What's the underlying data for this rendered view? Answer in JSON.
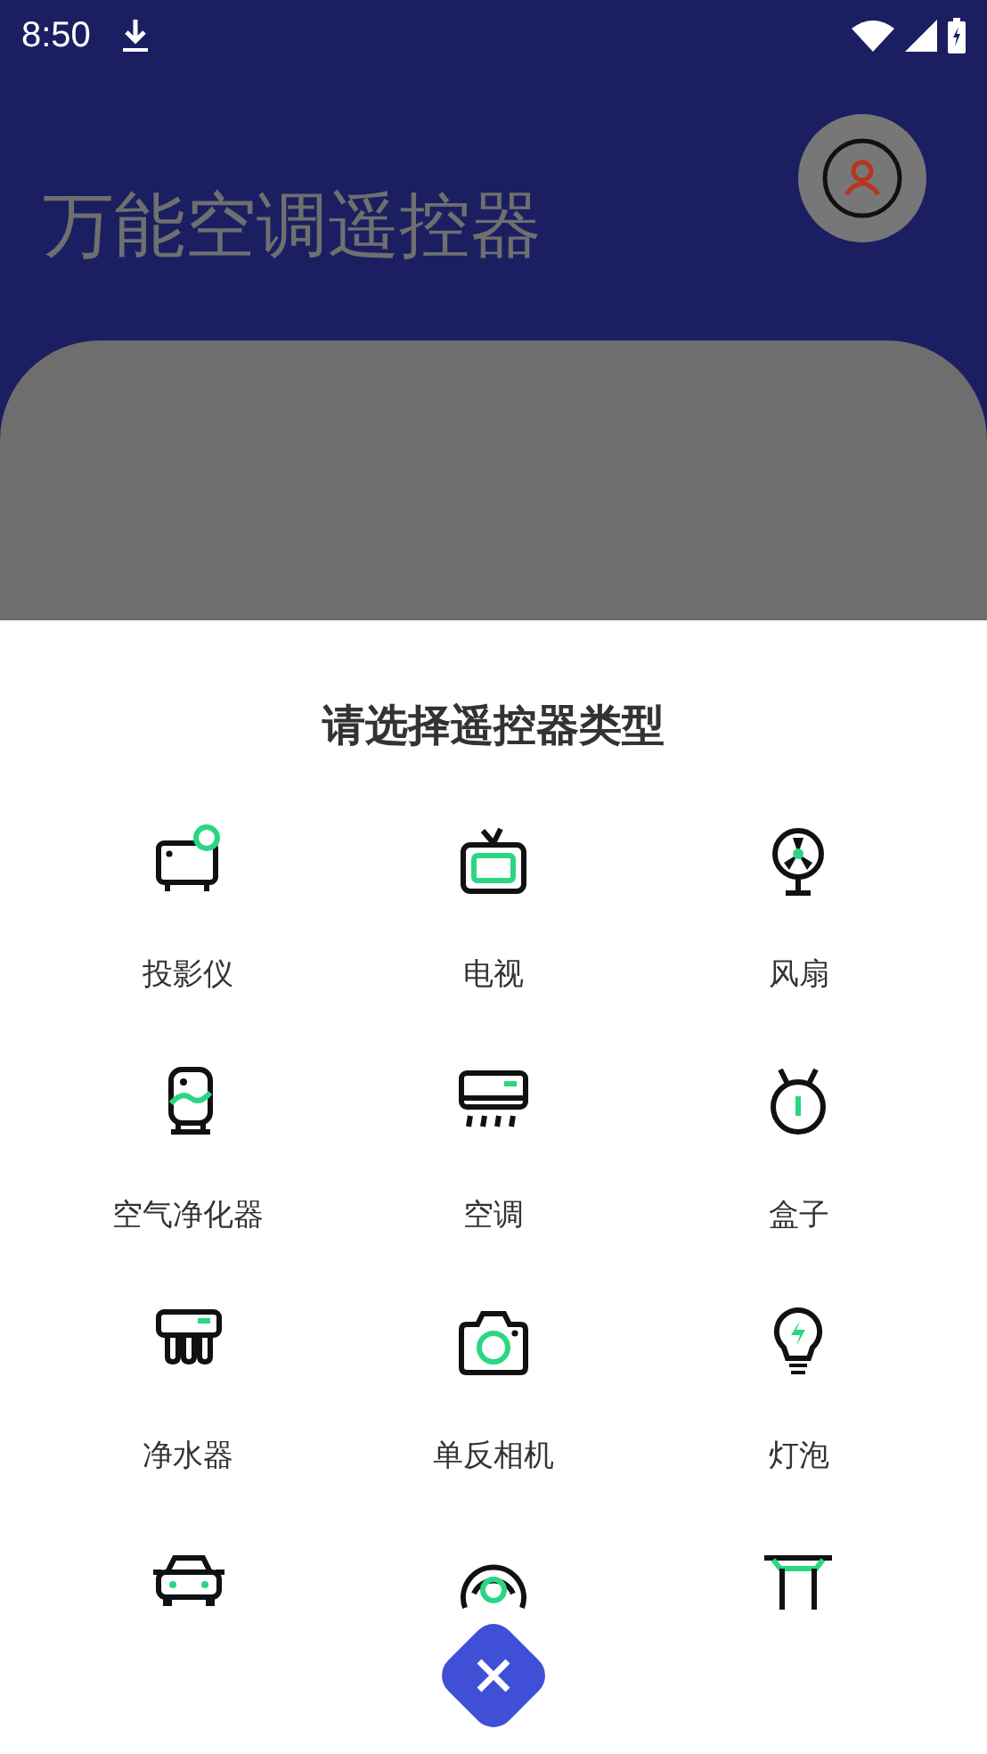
{
  "status_bar": {
    "time": "8:50"
  },
  "header": {
    "title": "万能空调遥控器"
  },
  "sheet": {
    "title": "请选择遥控器类型",
    "devices": [
      {
        "kind": "full",
        "label": "投影仪"
      },
      {
        "kind": "full",
        "label": "电视"
      },
      {
        "kind": "full",
        "label": "风扇"
      },
      {
        "kind": "full",
        "label": "空气净化器"
      },
      {
        "kind": "full",
        "label": "空调"
      },
      {
        "kind": "full",
        "label": "盒子"
      },
      {
        "kind": "full",
        "label": "净水器"
      },
      {
        "kind": "full",
        "label": "单反相机"
      },
      {
        "kind": "full",
        "label": "灯泡"
      },
      {
        "kind": "cut"
      },
      {
        "kind": "cut"
      },
      {
        "kind": "cut"
      }
    ]
  }
}
